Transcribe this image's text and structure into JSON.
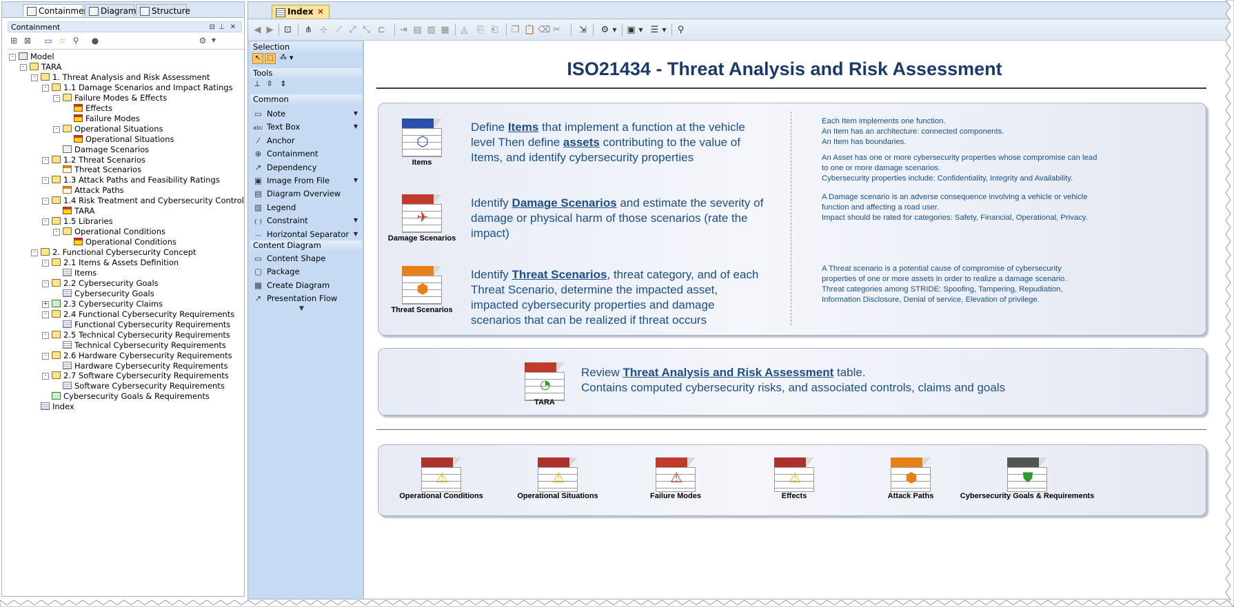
{
  "left_tabs": [
    "Containment",
    "Diagrams",
    "Structure"
  ],
  "containment_header": "Containment",
  "tree": [
    {
      "label": "Model",
      "level": 0,
      "icon": "model",
      "toggle": "-"
    },
    {
      "label": "TARA",
      "level": 1,
      "icon": "folder",
      "toggle": "-"
    },
    {
      "label": "1. Threat Analysis and Risk Assessment",
      "level": 2,
      "icon": "folder",
      "toggle": "-"
    },
    {
      "label": "1.1 Damage Scenarios and Impact Ratings",
      "level": 3,
      "icon": "folder",
      "toggle": "-"
    },
    {
      "label": "Failure Modes & Effects",
      "level": 4,
      "icon": "folder",
      "toggle": "-"
    },
    {
      "label": "Effects",
      "level": 5,
      "icon": "warn"
    },
    {
      "label": "Failure Modes",
      "level": 5,
      "icon": "warn"
    },
    {
      "label": "Operational Situations",
      "level": 4,
      "icon": "folder",
      "toggle": "-"
    },
    {
      "label": "Operational Situations",
      "level": 5,
      "icon": "warn"
    },
    {
      "label": "Damage Scenarios",
      "level": 4,
      "icon": "diag"
    },
    {
      "label": "1.2 Threat Scenarios",
      "level": 3,
      "icon": "folder",
      "toggle": "-"
    },
    {
      "label": "Threat Scenarios",
      "level": 4,
      "icon": "orange"
    },
    {
      "label": "1.3 Attack Paths and Feasibility Ratings",
      "level": 3,
      "icon": "folder",
      "toggle": "-"
    },
    {
      "label": "Attack Paths",
      "level": 4,
      "icon": "orange"
    },
    {
      "label": "1.4 Risk Treatment and Cybersecurity Control",
      "level": 3,
      "icon": "folder",
      "toggle": "-"
    },
    {
      "label": "TARA",
      "level": 4,
      "icon": "warn"
    },
    {
      "label": "1.5 Libraries",
      "level": 3,
      "icon": "folder",
      "toggle": "-"
    },
    {
      "label": "Operational Conditions",
      "level": 4,
      "icon": "folder",
      "toggle": "-"
    },
    {
      "label": "Operational Conditions",
      "level": 5,
      "icon": "warn"
    },
    {
      "label": "2. Functional Cybersecurity Concept",
      "level": 2,
      "icon": "folder",
      "toggle": "-"
    },
    {
      "label": "2.1 Items & Assets Definition",
      "level": 3,
      "icon": "folder",
      "toggle": "-"
    },
    {
      "label": "Items",
      "level": 4,
      "icon": "table"
    },
    {
      "label": "2.2 Cybersecurity Goals",
      "level": 3,
      "icon": "folder",
      "toggle": "-"
    },
    {
      "label": "Cybersecurity Goals",
      "level": 4,
      "icon": "table"
    },
    {
      "label": "2.3 Cybersecurity Claims",
      "level": 3,
      "icon": "claim",
      "toggle": "+"
    },
    {
      "label": "2.4 Functional Cybersecurity Requirements",
      "level": 3,
      "icon": "folder",
      "toggle": "-"
    },
    {
      "label": "Functional Cybersecurity Requirements",
      "level": 4,
      "icon": "table"
    },
    {
      "label": "2.5 Technical Cybersecurity Requirements",
      "level": 3,
      "icon": "folder",
      "toggle": "-"
    },
    {
      "label": "Technical Cybersecurity Requirements",
      "level": 4,
      "icon": "table"
    },
    {
      "label": "2.6 Hardware Cybersecurity Requirements",
      "level": 3,
      "icon": "folder",
      "toggle": "-"
    },
    {
      "label": "Hardware Cybersecurity Requirements",
      "level": 4,
      "icon": "table"
    },
    {
      "label": "2.7 Software Cybersecurity Requirements",
      "level": 3,
      "icon": "folder",
      "toggle": "-"
    },
    {
      "label": "Software Cybersecurity Requirements",
      "level": 4,
      "icon": "table"
    },
    {
      "label": "Cybersecurity Goals & Requirements",
      "level": 3,
      "icon": "claim"
    },
    {
      "label": "Index",
      "level": 2,
      "icon": "table"
    }
  ],
  "editor_tab": "Index",
  "palette": {
    "groups": {
      "selection": "Selection",
      "tools": "Tools",
      "common": "Common",
      "content": "Content Diagram"
    },
    "common_items": [
      {
        "label": "Note",
        "icon": "▭",
        "arrow": true
      },
      {
        "label": "Text Box",
        "icon": "abc",
        "arrow": true
      },
      {
        "label": "Anchor",
        "icon": "⁄",
        "arrow": false
      },
      {
        "label": "Containment",
        "icon": "⊕",
        "arrow": false
      },
      {
        "label": "Dependency",
        "icon": "↗",
        "arrow": false
      },
      {
        "label": "Image From File",
        "icon": "▣",
        "arrow": true
      },
      {
        "label": "Diagram Overview",
        "icon": "▤",
        "arrow": false
      },
      {
        "label": "Legend",
        "icon": "▥",
        "arrow": false
      },
      {
        "label": "Constraint",
        "icon": "{ }",
        "arrow": true
      },
      {
        "label": "Horizontal Separator",
        "icon": "---",
        "arrow": true
      }
    ],
    "content_items": [
      {
        "label": "Content Shape",
        "icon": "▭"
      },
      {
        "label": "Package",
        "icon": "▢"
      },
      {
        "label": "Create Diagram",
        "icon": "▦"
      },
      {
        "label": "Presentation Flow",
        "icon": "↗"
      }
    ]
  },
  "canvas": {
    "title": "ISO21434 - Threat Analysis and Risk Assessment",
    "sections": [
      {
        "icon_label": "Items",
        "icon_color": "#2b4ea6",
        "text_pre": "Define ",
        "link1": "Items",
        "text_mid": " that implement a function at the vehicle level Then define ",
        "link2": "assets",
        "text_post": " contributing to the value of Items, and identify cybersecurity properties",
        "notes": [
          "Each Item implements one function.",
          "An Item has an architecture: connected components.",
          "An Item has boundaries.",
          "",
          "An Asset has one or more cybersecurity properties whose compromise can lead to one or more damage scenarios.",
          "Cybersecurity properties include: Confidentiality, Integrity and Availability."
        ]
      },
      {
        "icon_label": "Damage Scenarios",
        "icon_color": "#c0392b",
        "text_pre": "Identify ",
        "link1": "Damage Scenarios",
        "text_mid": " and estimate the severity of damage or physical harm of those scenarios (rate the impact)",
        "link2": "",
        "text_post": "",
        "notes": [
          "A Damage scenario is an adverse consequence involving a vehicle or vehicle function and affecting a road user.",
          "Impact should be rated for categories: Safety, Financial, Operational, Privacy."
        ]
      },
      {
        "icon_label": "Threat Scenarios",
        "icon_color": "#e8801a",
        "text_pre": "Identify ",
        "link1": "Threat Scenarios",
        "text_mid": ", threat category, and of each Threat Scenario, determine the impacted asset, impacted cybersecurity properties and damage scenarios that can be realized if threat occurs",
        "link2": "",
        "text_post": "",
        "notes": [
          "A Threat scenario is a potential cause of compromise of cybersecurity properties of one or more assets in order to realize a damage scenario.",
          "Threat categories among STRIDE: Spoofing, Tampering, Repudiation, Information Disclosure, Denial of service, Elevation of privilege."
        ]
      }
    ],
    "review": {
      "icon_label": "TARA",
      "pre": "Review ",
      "link": "Threat Analysis and Risk Assessment",
      "post": " table.",
      "line2": "Contains computed cybersecurity risks, and associated controls, claims and goals"
    },
    "bottom_icons": [
      {
        "label": "Operational Conditions",
        "color": "#b03030",
        "emb": "warning"
      },
      {
        "label": "Operational Situations",
        "color": "#b03030",
        "emb": "warning"
      },
      {
        "label": "Failure Modes",
        "color": "#c0392b",
        "emb": "warning-red"
      },
      {
        "label": "Effects",
        "color": "#b03030",
        "emb": "warning"
      },
      {
        "label": "Attack Paths",
        "color": "#e8801a",
        "emb": "path"
      },
      {
        "label": "Cybersecurity Goals & Requirements",
        "color": "#555555",
        "emb": "shield"
      }
    ]
  }
}
